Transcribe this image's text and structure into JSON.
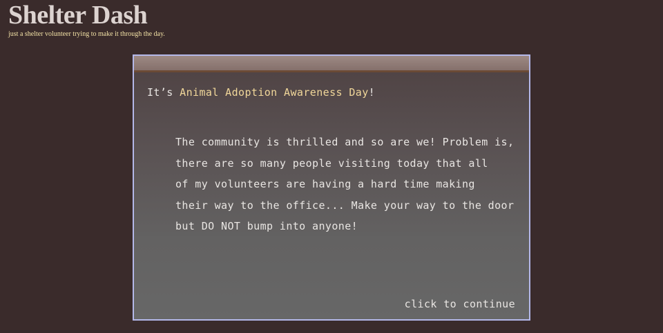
{
  "header": {
    "title": "Shelter Dash",
    "subtitle": "just a shelter volunteer trying to make it through the day."
  },
  "dialog": {
    "intro_prefix": "It’s ",
    "intro_highlight": "Animal Adoption Awareness Day",
    "intro_suffix": "!",
    "body_lines": [
      "The community is thrilled and so are we! Problem is,",
      "there are so many people visiting today that all",
      "of my volunteers are having a hard time making",
      "their way to the office... Make your way to the door",
      "but DO NOT bump into anyone!"
    ],
    "continue_label": "click to continue"
  },
  "colors": {
    "background": "#3a2b2b",
    "highlight": "#f1d79a",
    "dialog_border": "#b4b8ea",
    "subtitle": "#f3e2a6"
  }
}
